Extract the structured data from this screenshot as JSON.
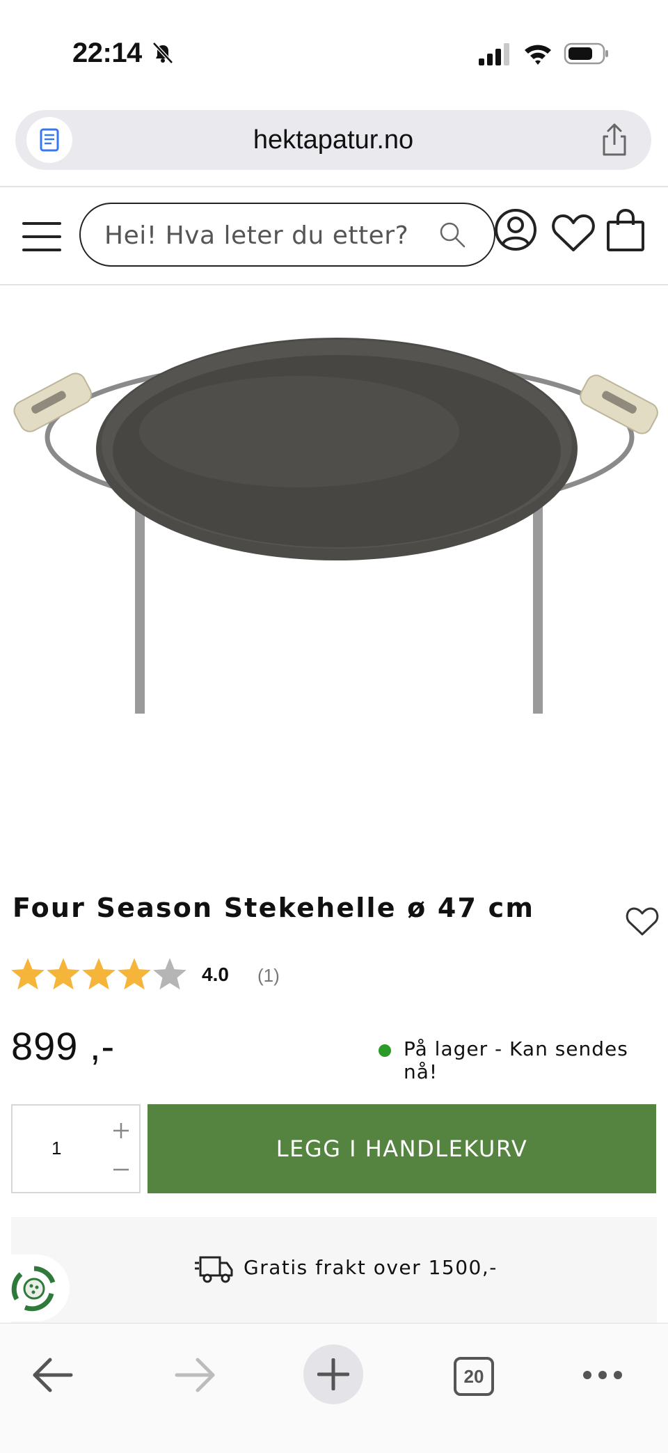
{
  "status_bar": {
    "time": "22:14"
  },
  "browser": {
    "url": "hektapatur.no",
    "open_tabs_count": "20"
  },
  "header": {
    "search_placeholder": "Hei! Hva leter du etter?"
  },
  "product": {
    "title": "Four Season Stekehelle ø 47 cm",
    "rating": "4.0",
    "rating_stars": 4,
    "review_count": "(1)",
    "price": "899 ,-",
    "stock_status": "På lager - Kan sendes nå!",
    "quantity": "1",
    "add_to_cart_label": "LEGG I HANDLEKURV"
  },
  "shipping": {
    "text": "Gratis frakt over 1500,-"
  },
  "colors": {
    "brand_green": "#54843f",
    "stock_green": "#2b9a26",
    "star_gold": "#f5b43a",
    "star_gray": "#b5b5b5"
  },
  "icons": [
    "bell-off-icon",
    "signal-icon",
    "wifi-icon",
    "battery-icon",
    "reader-icon",
    "share-icon",
    "menu-icon",
    "search-icon",
    "account-icon",
    "heart-icon",
    "cart-icon",
    "plus-icon",
    "minus-icon",
    "truck-icon",
    "recycle-icon",
    "back-arrow-icon",
    "forward-arrow-icon",
    "new-tab-icon",
    "more-icon"
  ]
}
